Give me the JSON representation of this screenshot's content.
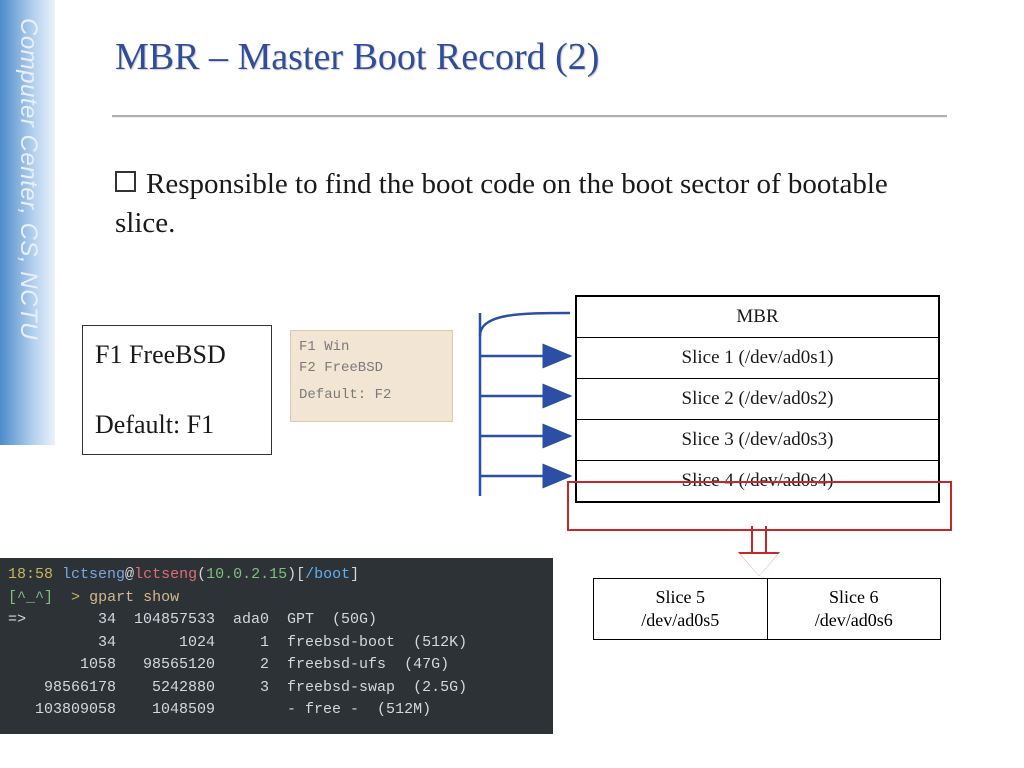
{
  "sidebar": {
    "label": "Computer Center, CS, NCTU"
  },
  "title": "MBR – Master Boot Record (2)",
  "bullet": "Responsible to find the boot code on the boot sector of bootable slice.",
  "bootbox1": {
    "line1": "F1 FreeBSD",
    "line2": "Default: F1"
  },
  "bootbox2": {
    "line1": "F1 Win",
    "line2": "F2 FreeBSD",
    "line3": "Default: F2"
  },
  "pt": {
    "rows": [
      "MBR",
      "Slice 1 (/dev/ad0s1)",
      "Slice 2 (/dev/ad0s2)",
      "Slice 3 (/dev/ad0s3)",
      "Slice 4 (/dev/ad0s4)"
    ]
  },
  "ext": {
    "c1a": "Slice 5",
    "c1b": "/dev/ad0s5",
    "c2a": "Slice 6",
    "c2b": "/dev/ad0s6"
  },
  "term": {
    "time": "18:58",
    "user": "lctseng",
    "host": "lctseng",
    "ip": "10.0.2.15",
    "path": "/boot",
    "face": "[^_^]",
    "cmd": "gpart show",
    "l3": "=>        34  104857533  ada0  GPT  (50G)",
    "l4": "          34       1024     1  freebsd-boot  (512K)",
    "l5": "        1058   98565120     2  freebsd-ufs  (47G)",
    "l6": "    98566178    5242880     3  freebsd-swap  (2.5G)",
    "l7": "   103809058    1048509        - free -  (512M)"
  }
}
